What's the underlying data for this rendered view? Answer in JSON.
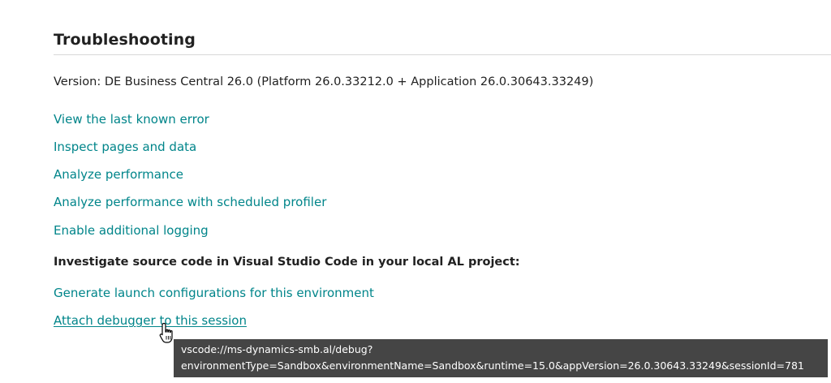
{
  "section": {
    "title": "Troubleshooting",
    "version_text": "Version: DE Business Central 26.0 (Platform 26.0.33212.0 + Application 26.0.30643.33249)"
  },
  "links": [
    {
      "label": "View the last known error"
    },
    {
      "label": "Inspect pages and data"
    },
    {
      "label": "Analyze performance"
    },
    {
      "label": "Analyze performance with scheduled profiler"
    },
    {
      "label": "Enable additional logging"
    }
  ],
  "vscode": {
    "heading": "Investigate source code in Visual Studio Code in your local AL project:",
    "links": [
      {
        "label": "Generate launch configurations for this environment"
      },
      {
        "label": "Attach debugger to this session"
      }
    ]
  },
  "tooltip": {
    "line1": "vscode://ms-dynamics-smb.al/debug?",
    "line2": "environmentType=Sandbox&environmentName=Sandbox&runtime=15.0&appVersion=26.0.30643.33249&sessionId=781"
  },
  "colors": {
    "link": "#00858a",
    "text": "#212121",
    "tooltip_bg": "#454545"
  },
  "icons": {
    "cursor": "hand-pointer-icon"
  }
}
